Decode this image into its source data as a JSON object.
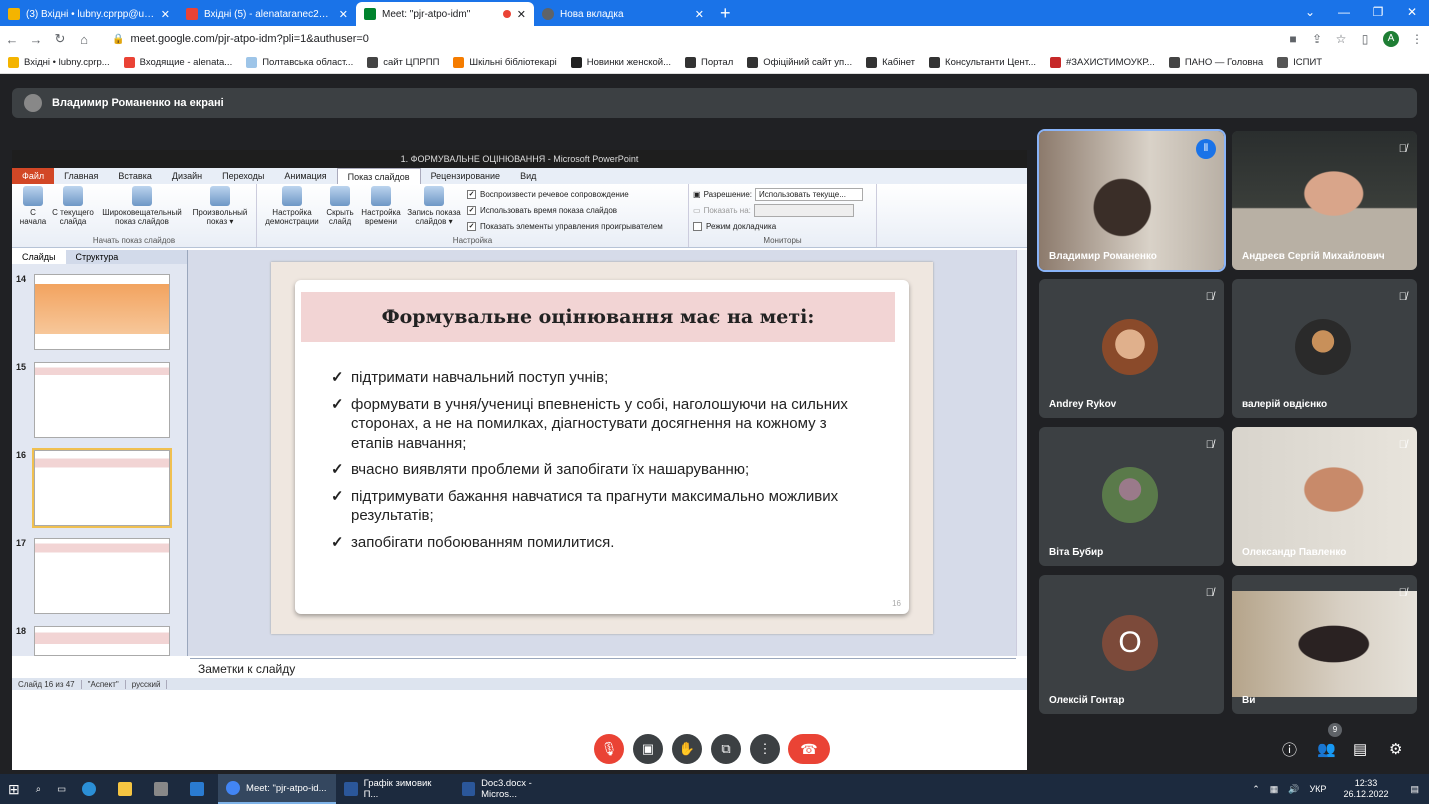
{
  "browser": {
    "tabs": [
      {
        "label": "(3) Вхідні • lubny.cprpp@ukr.net",
        "color": "#f4b400"
      },
      {
        "label": "Вхідні (5) - alenataranec2019@gmail.com",
        "color": "#ea4335"
      },
      {
        "label": "Meet: \"pjr-atpo-idm\"",
        "color": "#00832d"
      },
      {
        "label": "Нова вкладка",
        "color": "#5f6368"
      }
    ],
    "url": "meet.google.com/pjr-atpo-idm?pli=1&authuser=0",
    "profile": "A",
    "bookmarks": [
      {
        "label": "Вхідні • lubny.cprp...",
        "color": "#f4b400"
      },
      {
        "label": "Входящие - alenata...",
        "color": "#ea4335"
      },
      {
        "label": "Полтавська област...",
        "color": "#9ec5e8"
      },
      {
        "label": "сайт ЦПРПП",
        "color": "#444"
      },
      {
        "label": "Шкільні бібліотекарі",
        "color": "#f57c00"
      },
      {
        "label": "Новинки женской...",
        "color": "#222"
      },
      {
        "label": "Портал",
        "color": "#333"
      },
      {
        "label": "Офіційний сайт уп...",
        "color": "#333"
      },
      {
        "label": "Кабінет",
        "color": "#333"
      },
      {
        "label": "Консультанти Цент...",
        "color": "#333"
      },
      {
        "label": "#ЗАХИСТИМОУКР...",
        "color": "#c62828"
      },
      {
        "label": "ПАНО — Головна",
        "color": "#444"
      },
      {
        "label": "ІСПИТ",
        "color": "#555"
      }
    ]
  },
  "meet": {
    "presenting": "Владимир Романенко на екрані",
    "time": "12:33",
    "code": "pjr-atpo-idm",
    "people_count": "9",
    "participants": [
      {
        "name": "Владимир Романенко",
        "type": "video",
        "muted": false
      },
      {
        "name": "Андреєв Сергій Михайлович",
        "type": "video",
        "muted": true
      },
      {
        "name": "Andrey Rykov",
        "type": "avatar",
        "muted": true
      },
      {
        "name": "валерій овдієнко",
        "type": "avatar",
        "muted": true
      },
      {
        "name": "Віта Бубир",
        "type": "avatar",
        "muted": true
      },
      {
        "name": "Олександр Павленко",
        "type": "video",
        "muted": true
      },
      {
        "name": "Олексій Гонтар",
        "type": "letter",
        "letter": "О",
        "muted": true
      },
      {
        "name": "Ви",
        "type": "video",
        "muted": true
      }
    ]
  },
  "ppt": {
    "title": "1. ФОРМУВАЛЬНЕ ОЦІНЮВАННЯ - Microsoft PowerPoint",
    "ribbon_tabs": [
      "Файл",
      "Главная",
      "Вставка",
      "Дизайн",
      "Переходы",
      "Анимация",
      "Показ слайдов",
      "Рецензирование",
      "Вид"
    ],
    "group1": {
      "caption": "Начать показ слайдов",
      "buttons": [
        "С начала",
        "С текущего слайда",
        "Широковещательный показ слайдов",
        "Произвольный показ ▾"
      ]
    },
    "group2": {
      "caption": "Настройка",
      "buttons": [
        "Настройка демонстрации",
        "Скрыть слайд",
        "Настройка времени",
        "Запись показа слайдов ▾"
      ],
      "checks": [
        {
          "label": "Воспроизвести речевое сопровождение",
          "checked": "✓"
        },
        {
          "label": "Использовать время показа слайдов",
          "checked": "✓"
        },
        {
          "label": "Показать элементы управления проигрывателем",
          "checked": "✓"
        }
      ]
    },
    "group3": {
      "caption": "Мониторы",
      "resolution_label": "Разрешение:",
      "resolution_value": "Использовать текуще...",
      "show_on_label": "Показать на:",
      "presenter_label": "Режим докладчика"
    },
    "panel_tabs": [
      "Слайды",
      "Структура"
    ],
    "thumb_numbers": [
      "14",
      "15",
      "16",
      "17",
      "18"
    ],
    "slide": {
      "heading": "Формувальне оцінювання має на меті:",
      "bullets": [
        "підтримати навчальний поступ учнів;",
        "формувати в учня/учениці впевненість у собі, наголошуючи на сильних сторонах, а не на помилках, діагностувати досягнення на кожному з етапів навчання;",
        "вчасно виявляти проблеми й запобігати їх нашаруванню;",
        "підтримувати бажання навчатися та прагнути максимально можливих результатів;",
        "запобігати побоюванням помилитися."
      ],
      "number": "16"
    },
    "notes": "Заметки к слайду",
    "status": [
      "Слайд 16 из 47",
      "\"Аспект\"",
      "русский"
    ]
  },
  "taskbar": {
    "apps": [
      {
        "label": "Meet: \"pjr-atpo-id...",
        "color": "#4285f4"
      },
      {
        "label": "Графік зимовик П...",
        "color": "#2b579a"
      },
      {
        "label": "Doc3.docx - Micros...",
        "color": "#2b579a"
      }
    ],
    "lang": "УКР",
    "time": "12:33",
    "date": "26.12.2022"
  }
}
